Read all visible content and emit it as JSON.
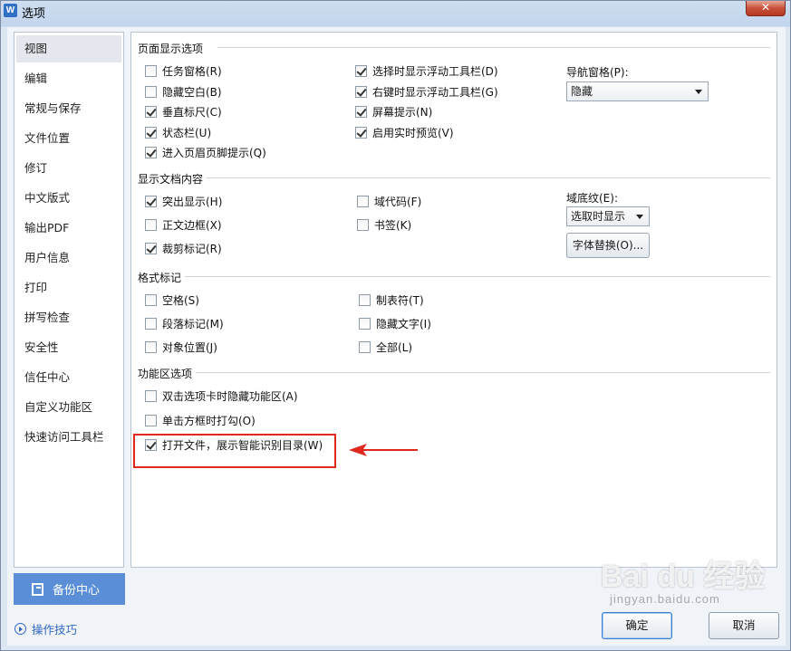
{
  "window": {
    "title": "选项",
    "app_icon_letter": "W",
    "close_glyph": "✕"
  },
  "sidebar": {
    "items": [
      {
        "label": "视图",
        "selected": true
      },
      {
        "label": "编辑"
      },
      {
        "label": "常规与保存"
      },
      {
        "label": "文件位置"
      },
      {
        "label": "修订"
      },
      {
        "label": "中文版式"
      },
      {
        "label": "输出PDF"
      },
      {
        "label": "用户信息"
      },
      {
        "label": "打印"
      },
      {
        "label": "拼写检查"
      },
      {
        "label": "安全性"
      },
      {
        "label": "信任中心"
      },
      {
        "label": "自定义功能区"
      },
      {
        "label": "快速访问工具栏"
      }
    ],
    "backup_label": "备份中心",
    "tips_label": "操作技巧"
  },
  "sections": {
    "page_display": {
      "title": "页面显示选项",
      "col1": [
        {
          "label": "任务窗格(R)",
          "checked": false
        },
        {
          "label": "隐藏空白(B)",
          "checked": false
        },
        {
          "label": "垂直标尺(C)",
          "checked": true
        },
        {
          "label": "状态栏(U)",
          "checked": true
        },
        {
          "label": "进入页眉页脚提示(Q)",
          "checked": true
        }
      ],
      "col2": [
        {
          "label": "选择时显示浮动工具栏(D)",
          "checked": true
        },
        {
          "label": "右键时显示浮动工具栏(G)",
          "checked": true
        },
        {
          "label": "屏幕提示(N)",
          "checked": true
        },
        {
          "label": "启用实时预览(V)",
          "checked": true
        }
      ],
      "nav_label": "导航窗格(P):",
      "nav_value": "隐藏"
    },
    "doc_content": {
      "title": "显示文档内容",
      "col1": [
        {
          "label": "突出显示(H)",
          "checked": true
        },
        {
          "label": "正文边框(X)",
          "checked": false
        },
        {
          "label": "裁剪标记(R)",
          "checked": true
        }
      ],
      "col2": [
        {
          "label": "域代码(F)",
          "checked": false
        },
        {
          "label": "书签(K)",
          "checked": false
        }
      ],
      "shading_label": "域底纹(E):",
      "shading_value": "选取时显示",
      "font_replace_label": "字体替换(O)..."
    },
    "format_marks": {
      "title": "格式标记",
      "col1": [
        {
          "label": "空格(S)",
          "checked": false
        },
        {
          "label": "段落标记(M)",
          "checked": false
        },
        {
          "label": "对象位置(J)",
          "checked": false
        }
      ],
      "col2": [
        {
          "label": "制表符(T)",
          "checked": false
        },
        {
          "label": "隐藏文字(I)",
          "checked": false
        },
        {
          "label": "全部(L)",
          "checked": false
        }
      ]
    },
    "ribbon": {
      "title": "功能区选项",
      "items": [
        {
          "label": "双击选项卡时隐藏功能区(A)",
          "checked": false
        },
        {
          "label": "单击方框时打勾(O)",
          "checked": false
        },
        {
          "label": "打开文件，展示智能识别目录(W)",
          "checked": true
        }
      ]
    }
  },
  "footer": {
    "ok_label": "确定",
    "cancel_label": "取消"
  },
  "watermark": {
    "brand": "Bai du 经验",
    "url": "jingyan.baidu.com"
  },
  "colors": {
    "accent": "#5a8fd8",
    "highlight": "#e0281e"
  }
}
